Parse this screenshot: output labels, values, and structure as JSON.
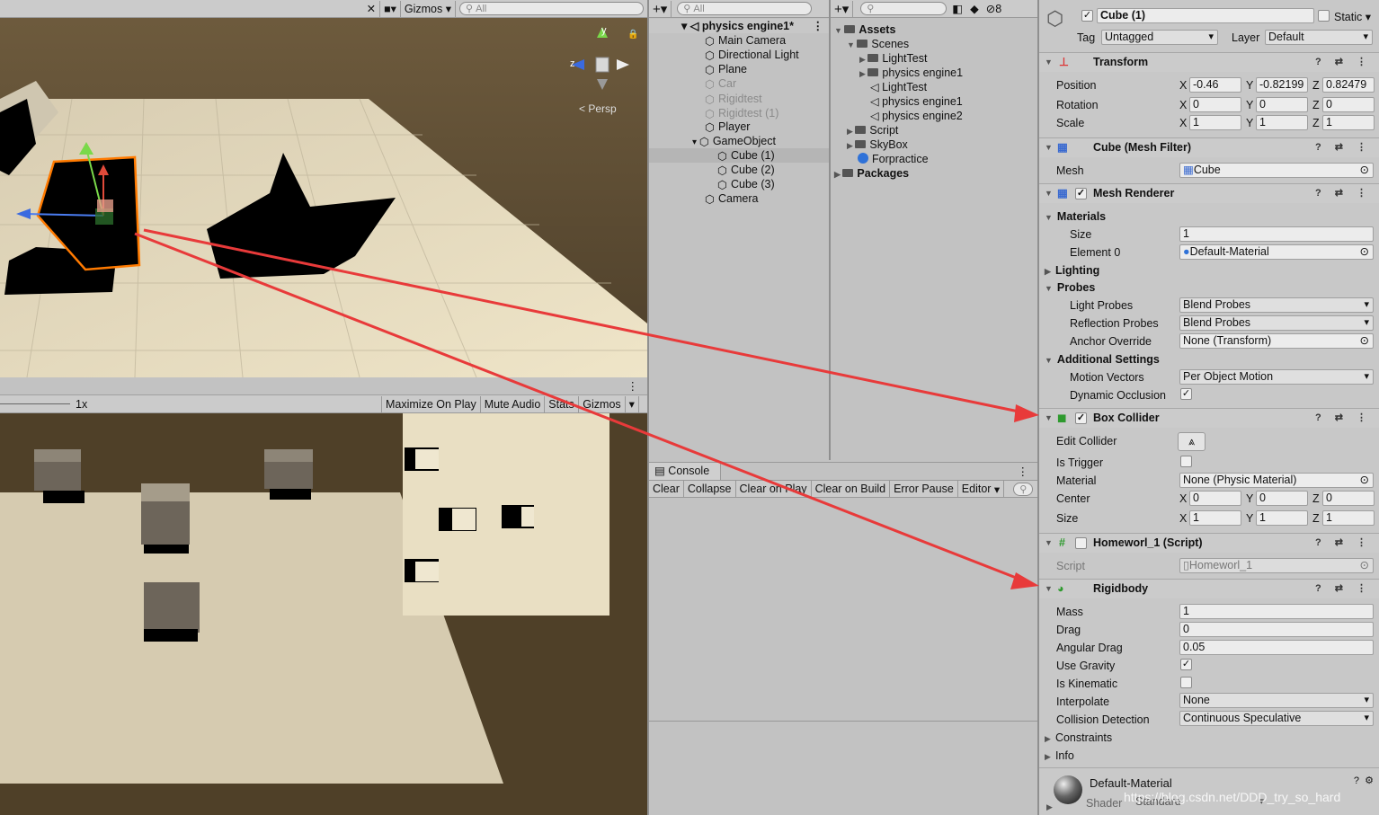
{
  "scene": {
    "gizmos": "Gizmos",
    "search": "All",
    "persp": "Persp",
    "axis_y": "y",
    "axis_z": "z"
  },
  "game": {
    "scale": "1x",
    "maximize": "Maximize On Play",
    "mute": "Mute Audio",
    "stats": "Stats",
    "gizmos": "Gizmos"
  },
  "hierarchy": {
    "search": "All",
    "scene_name": "physics engine1*",
    "items": [
      "Main Camera",
      "Directional Light",
      "Plane",
      "Car",
      "Rigidtest",
      "Rigidtest (1)",
      "Player",
      "GameObject",
      "Cube (1)",
      "Cube (2)",
      "Cube (3)",
      "Camera"
    ]
  },
  "project": {
    "badge": "8",
    "items": [
      "Assets",
      "Scenes",
      "LightTest",
      "physics engine1",
      "LightTest",
      "physics engine1",
      "physics engine2",
      "Script",
      "SkyBox",
      "Forpractice",
      "Packages"
    ]
  },
  "console": {
    "title": "Console",
    "buttons": [
      "Clear",
      "Collapse",
      "Clear on Play",
      "Clear on Build",
      "Error Pause",
      "Editor"
    ]
  },
  "inspector": {
    "name": "Cube (1)",
    "static": "Static",
    "tag_label": "Tag",
    "tag": "Untagged",
    "layer_label": "Layer",
    "layer": "Default",
    "transform": {
      "title": "Transform",
      "position_label": "Position",
      "rotation_label": "Rotation",
      "scale_label": "Scale",
      "position": [
        "-0.46",
        "-0.82199",
        "0.82479"
      ],
      "rotation": [
        "0",
        "0",
        "0"
      ],
      "scale": [
        "1",
        "1",
        "1"
      ],
      "axes": [
        "X",
        "Y",
        "Z"
      ]
    },
    "mesh_filter": {
      "title": "Cube (Mesh Filter)",
      "mesh_label": "Mesh",
      "mesh": "Cube"
    },
    "mesh_renderer": {
      "title": "Mesh Renderer",
      "materials": "Materials",
      "size_label": "Size",
      "size": "1",
      "element0_label": "Element 0",
      "element0": "Default-Material",
      "lighting": "Lighting",
      "probes": "Probes",
      "light_probes_label": "Light Probes",
      "light_probes": "Blend Probes",
      "reflection_probes_label": "Reflection Probes",
      "reflection_probes": "Blend Probes",
      "anchor_label": "Anchor Override",
      "anchor": "None (Transform)",
      "additional": "Additional Settings",
      "motion_label": "Motion Vectors",
      "motion": "Per Object Motion",
      "dynamic_label": "Dynamic Occlusion"
    },
    "box_collider": {
      "title": "Box Collider",
      "edit_label": "Edit Collider",
      "trigger_label": "Is Trigger",
      "material_label": "Material",
      "material": "None (Physic Material)",
      "center_label": "Center",
      "center": [
        "0",
        "0",
        "0"
      ],
      "size_label": "Size",
      "size": [
        "1",
        "1",
        "1"
      ]
    },
    "script": {
      "title": "Homeworl_1 (Script)",
      "label": "Script",
      "value": "Homeworl_1"
    },
    "rigidbody": {
      "title": "Rigidbody",
      "mass_label": "Mass",
      "mass": "1",
      "drag_label": "Drag",
      "drag": "0",
      "angular_label": "Angular Drag",
      "angular": "0.05",
      "gravity_label": "Use Gravity",
      "kinematic_label": "Is Kinematic",
      "interpolate_label": "Interpolate",
      "interpolate": "None",
      "collision_label": "Collision Detection",
      "collision": "Continuous Speculative",
      "constraints": "Constraints",
      "info": "Info"
    },
    "material": {
      "name": "Default-Material",
      "shader_label": "Shader",
      "shader": "Standard"
    },
    "watermark": "https://blog.csdn.net/DDD_try_so_hard"
  }
}
